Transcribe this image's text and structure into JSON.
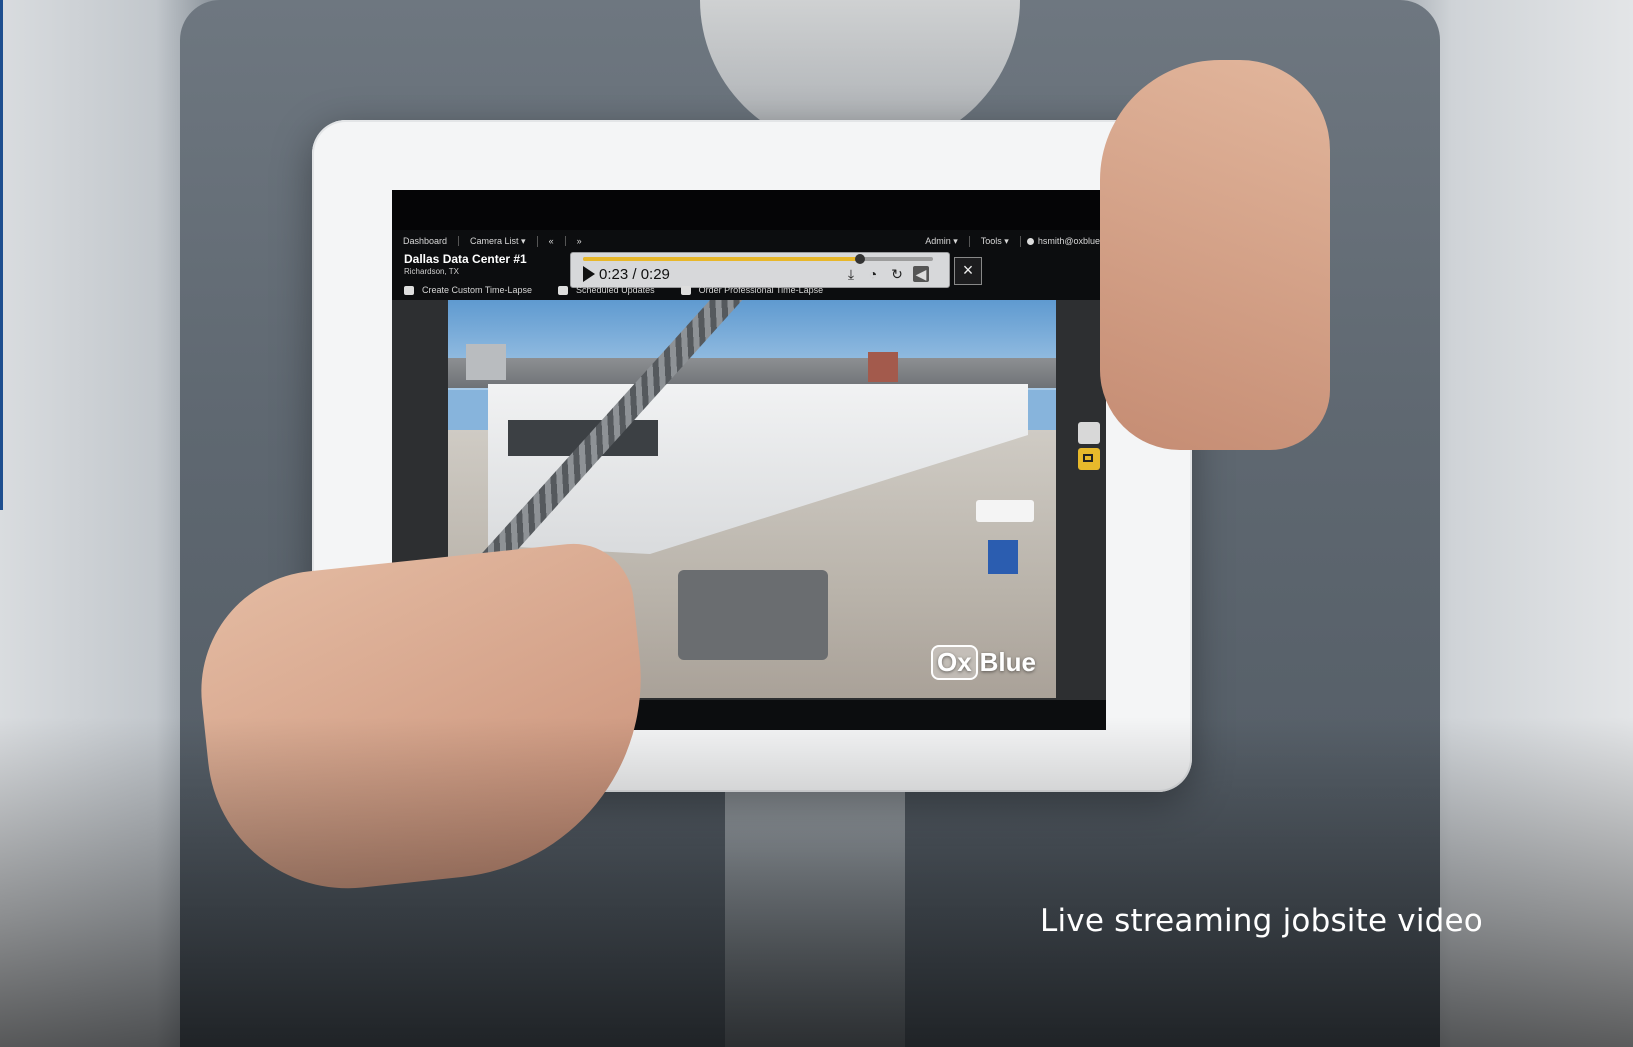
{
  "caption": "Live streaming jobsite video",
  "topnav": {
    "dashboard": "Dashboard",
    "camera_list": "Camera List",
    "prev": "«",
    "next": "»",
    "admin": "Admin",
    "tools": "Tools",
    "user": "hsmith@oxblue"
  },
  "camera": {
    "title": "Dallas Data Center #1",
    "location": "Richardson, TX"
  },
  "player": {
    "time": "0:23 / 0:29",
    "progress_fraction": 0.79,
    "close_label": "×"
  },
  "subnav": {
    "custom_timelapse": "Create Custom Time-Lapse",
    "scheduled_updates": "Scheduled Updates",
    "order_timelapse": "Order Professional Time-Lapse"
  },
  "watermark": {
    "ox": "Ox",
    "blue": "Blue"
  },
  "icons": {
    "play": "play-icon",
    "download": "download-icon",
    "speed": "speed-icon",
    "replay": "replay-icon",
    "volume": "volume-icon"
  },
  "colors": {
    "accent": "#e8b72a",
    "tablet_frame": "#f4f5f6",
    "screen_bg": "#0c0d0f"
  }
}
